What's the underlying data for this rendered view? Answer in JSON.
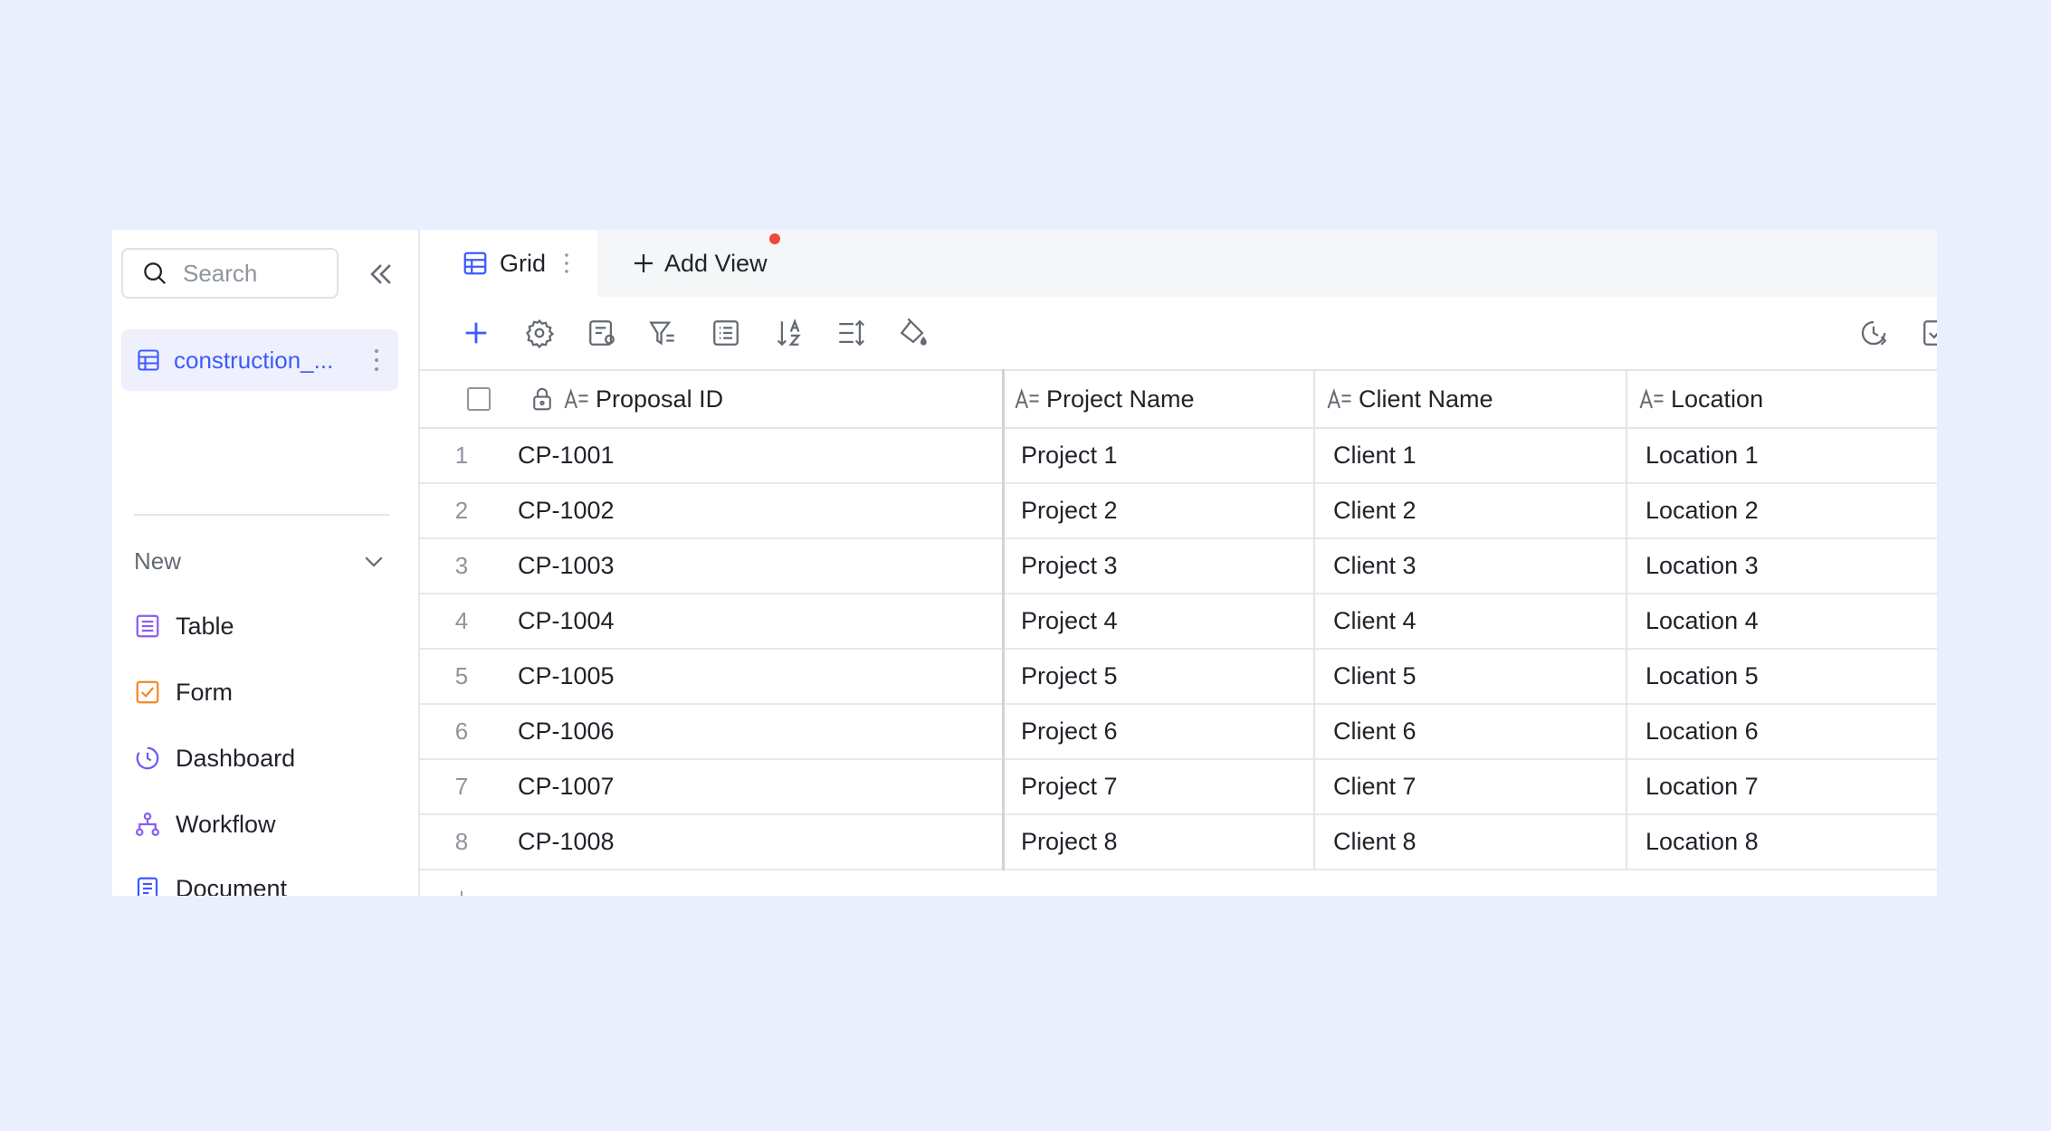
{
  "sidebar": {
    "search": {
      "placeholder": "Search"
    },
    "table_name": "construction_...",
    "new_label": "New",
    "new_items": [
      {
        "label": "Table",
        "icon": "table-icon"
      },
      {
        "label": "Form",
        "icon": "form-icon"
      },
      {
        "label": "Dashboard",
        "icon": "dashboard-icon"
      },
      {
        "label": "Workflow",
        "icon": "workflow-icon"
      },
      {
        "label": "Document",
        "icon": "document-icon"
      }
    ]
  },
  "tabs": {
    "active": "Grid",
    "add_view": "Add View"
  },
  "grid": {
    "columns": [
      "Proposal ID",
      "Project Name",
      "Client Name",
      "Location"
    ],
    "rows": [
      {
        "n": "1",
        "id": "CP-1001",
        "project": "Project 1",
        "client": "Client 1",
        "location": "Location 1"
      },
      {
        "n": "2",
        "id": "CP-1002",
        "project": "Project 2",
        "client": "Client 2",
        "location": "Location 2"
      },
      {
        "n": "3",
        "id": "CP-1003",
        "project": "Project 3",
        "client": "Client 3",
        "location": "Location 3"
      },
      {
        "n": "4",
        "id": "CP-1004",
        "project": "Project 4",
        "client": "Client 4",
        "location": "Location 4"
      },
      {
        "n": "5",
        "id": "CP-1005",
        "project": "Project 5",
        "client": "Client 5",
        "location": "Location 5"
      },
      {
        "n": "6",
        "id": "CP-1006",
        "project": "Project 6",
        "client": "Client 6",
        "location": "Location 6"
      },
      {
        "n": "7",
        "id": "CP-1007",
        "project": "Project 7",
        "client": "Client 7",
        "location": "Location 7"
      },
      {
        "n": "8",
        "id": "CP-1008",
        "project": "Project 8",
        "client": "Client 8",
        "location": "Location 8"
      }
    ],
    "add_row": "+"
  },
  "colors": {
    "accent": "#3d5afe",
    "background": "#e9effc",
    "notification_dot": "#f0463b"
  }
}
